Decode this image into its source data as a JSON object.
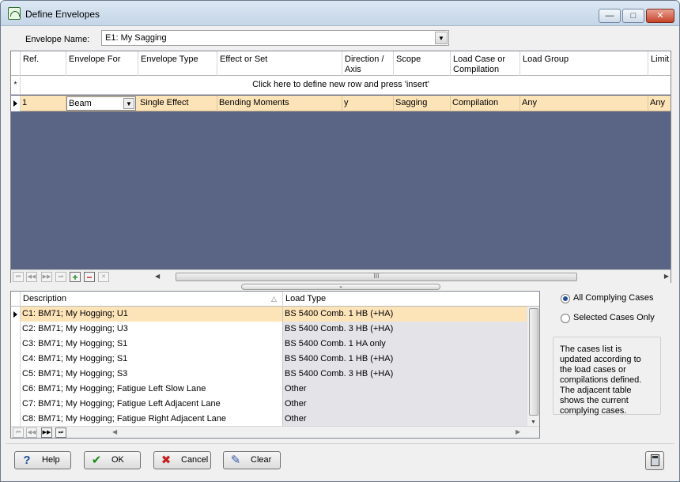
{
  "window": {
    "title": "Define Envelopes",
    "minimize_glyph": "—",
    "maximize_glyph": "□",
    "close_glyph": "✕"
  },
  "envelope_name": {
    "label": "Envelope Name:",
    "value": "E1: My Sagging",
    "arrow_glyph": "▼"
  },
  "top_grid": {
    "columns": [
      "Ref.",
      "Envelope For",
      "Envelope Type",
      "Effect or Set",
      "Direction / Axis",
      "Scope",
      "Load Case or Compilation",
      "Load Group",
      "Limit S"
    ],
    "new_row_marker": "*",
    "new_row_text": "Click here to define new row and press 'insert'",
    "rows": [
      {
        "ref": "1",
        "envelope_for": "Beam",
        "envelope_type": "Single Effect",
        "effect": "Bending Moments",
        "direction": "y",
        "scope": "Sagging",
        "load_case": "Compilation",
        "load_group": "Any",
        "limit": "Any"
      }
    ],
    "scroll_thumb_glyph": "III",
    "nav": {
      "first": "⏮",
      "prev": "◀◀",
      "next": "▶▶",
      "last": "⏭",
      "add": "+",
      "remove": "−",
      "delete": "✕"
    }
  },
  "splitter_glyph": "⌄",
  "cases_grid": {
    "columns": [
      "Description",
      "Load Type"
    ],
    "sort_glyph": "△",
    "rows": [
      {
        "description": "C1: BM71; My Hogging; U1",
        "load_type": "BS 5400 Comb. 1 HB (+HA)"
      },
      {
        "description": "C2: BM71; My Hogging; U3",
        "load_type": "BS 5400 Comb. 3 HB (+HA)"
      },
      {
        "description": "C3: BM71; My Hogging; S1",
        "load_type": "BS 5400 Comb. 1 HA only"
      },
      {
        "description": "C4: BM71; My Hogging; S1",
        "load_type": "BS 5400 Comb. 1 HB (+HA)"
      },
      {
        "description": "C5: BM71; My Hogging; S3",
        "load_type": "BS 5400 Comb. 3 HB (+HA)"
      },
      {
        "description": "C6: BM71; My Hogging; Fatigue Left Slow Lane",
        "load_type": "Other"
      },
      {
        "description": "C7: BM71; My Hogging; Fatigue Left Adjacent Lane",
        "load_type": "Other"
      },
      {
        "description": "C8: BM71; My Hogging; Fatigue Right Adjacent Lane",
        "load_type": "Other"
      }
    ]
  },
  "options": {
    "all_complying": "All Complying Cases",
    "selected_only": "Selected Cases Only",
    "selected": "all_complying"
  },
  "info_text": "The cases list is updated according to the load cases or compilations defined.  The adjacent table shows the current complying cases.",
  "buttons": {
    "help": "Help",
    "ok": "OK",
    "cancel": "Cancel",
    "clear": "Clear"
  },
  "colors": {
    "selected_row": "#fde3b8",
    "grid_empty": "#5a6484",
    "ok_check": "#1c8a1c",
    "cancel_x": "#c81e1e"
  }
}
